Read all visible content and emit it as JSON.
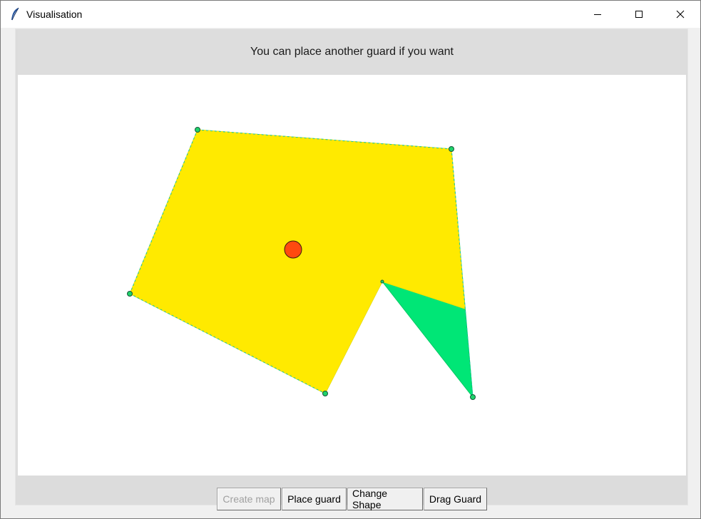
{
  "window": {
    "title": "Visualisation"
  },
  "message": "You can place another guard if you want",
  "buttons": {
    "create_map": "Create map",
    "place_guard": "Place guard",
    "change_shape": "Change Shape",
    "drag_guard": "Drag Guard"
  },
  "colors": {
    "visible_area": "#ffea00",
    "polygon_fill": "#00e676",
    "guard": "#ff4a0f",
    "vertex": "#1fd36a",
    "message_bar": "#dddddd",
    "canvas": "#ffffff"
  },
  "icons": {
    "app": "feather-icon",
    "minimize": "minimize-icon",
    "maximize": "maximize-icon",
    "close": "close-icon"
  }
}
